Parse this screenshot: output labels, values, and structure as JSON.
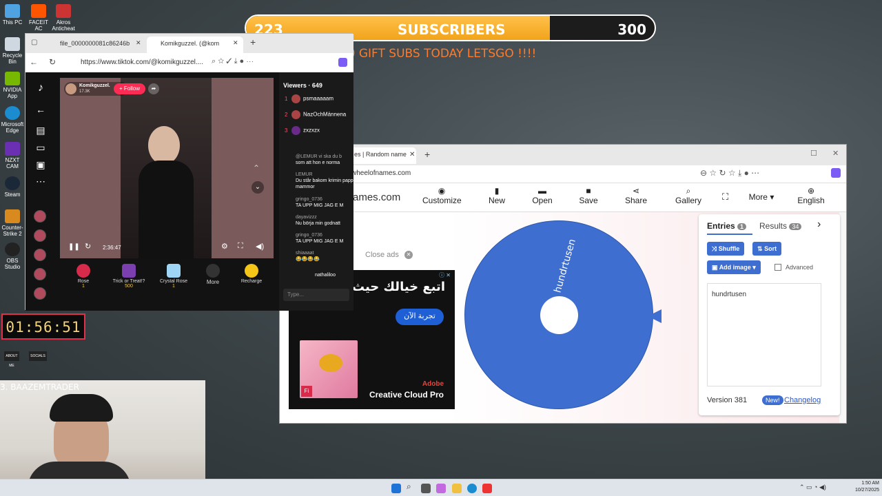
{
  "desktop_icons": [
    "This PC",
    "FACEIT AC",
    "Akros Anticheat",
    "Recycle Bin",
    "NVIDIA App",
    "Microsoft Edge",
    "NZXT CAM",
    "Steam",
    "Counter-Strike 2",
    "OBS Studio"
  ],
  "subs": {
    "current": "223",
    "label": "SUBSCRIBERS",
    "goal": "300",
    "progress": 0.743,
    "gift_text": "300 GIFT SUBS TODAY LETSGO !!!!"
  },
  "browser1": {
    "tabs": [
      {
        "label": "file_0000000081c86246b"
      },
      {
        "label": "Komikguzzel. (@kom"
      }
    ],
    "url": "https://www.tiktok.com/@komikguzzel....",
    "tiktok": {
      "streamer": "Komikguzzel.",
      "streamer_sub": "17.3K",
      "follow": "+ Follow",
      "time": "2:36:47",
      "viewers_label": "Viewers · 649",
      "viewers": [
        {
          "rank": "1",
          "name": "psmaaaaam"
        },
        {
          "rank": "2",
          "name": "NazOchMännena"
        },
        {
          "rank": "3",
          "name": "zxzxzx"
        }
      ],
      "chat": [
        {
          "user": "@LEMUR vi ska du b",
          "msg": "som att hon e norma"
        },
        {
          "user": "LEMUR",
          "msg": "Du står bakom krimin pappor och mammor"
        },
        {
          "user": "gringo_0736",
          "msg": "TA UPP MIG JAG E M"
        },
        {
          "user": "dayavizzz",
          "msg": "Nu börja min godnatt"
        },
        {
          "user": "gringo_0736",
          "msg": "TA UPP MIG JAG E M"
        },
        {
          "user": "shiaaaat",
          "msg": "😂😂😂😂"
        },
        {
          "user": "",
          "msg": "nathaliloo"
        }
      ],
      "type_placeholder": "Type...",
      "gifts": [
        {
          "name": "Rose",
          "cost": "1"
        },
        {
          "name": "Trick or Treat!?",
          "cost": "500"
        },
        {
          "name": "Crystal Rose",
          "cost": "1"
        },
        {
          "name": "More",
          "cost": ""
        },
        {
          "name": "Recharge",
          "cost": ""
        }
      ]
    }
  },
  "browser2": {
    "tab": "es | Random name",
    "url": "wheelofnames.com",
    "site_name": "ames.com",
    "toolbar": [
      "Customize",
      "New",
      "Open",
      "Save",
      "Share",
      "Gallery",
      "More",
      "English"
    ],
    "close_ads": "Close ads",
    "ad": {
      "arabic": "اتبع خيالك حيث",
      "cta": "تجربة الآن",
      "brand": "Adobe",
      "product": "Creative Cloud Pro"
    },
    "wheel_entry": "hundrtusen",
    "panel": {
      "entries_label": "Entries",
      "entries_count": "1",
      "results_label": "Results",
      "results_count": "34",
      "shuffle": "Shuffle",
      "sort": "Sort",
      "add_image": "Add image",
      "advanced": "Advanced",
      "entries_text": "hundrtusen",
      "version": "Version 381",
      "new_badge": "New!",
      "changelog": "Changelog"
    }
  },
  "timer": "01:56:51",
  "overlay_text": [
    "ABOUT ME",
    "SOCIALS",
    "3.  BAAZEMTRADER"
  ],
  "taskbar": {
    "time": "1:50 AM",
    "date": "10/27/2025"
  },
  "colors": {
    "accent_blue": "#3d6ed0",
    "subs_orange": "#f2a31b",
    "tiktok_red": "#fe2c55"
  }
}
